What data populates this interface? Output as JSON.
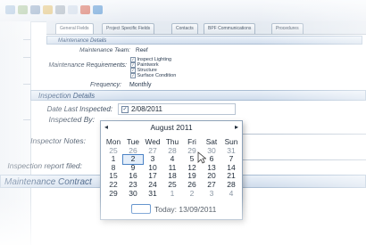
{
  "tabs": [
    {
      "label": "General Fields"
    },
    {
      "label": "Project Specific Fields"
    },
    {
      "label": "Contacts"
    },
    {
      "label": "BPF Communications"
    },
    {
      "label": "Procedures"
    }
  ],
  "maintenance_details": {
    "header": "Maintenance Details",
    "team_label": "Maintenance Team:",
    "team_value": "Reef",
    "requirements_label": "Maintenance Requirements:",
    "requirements": [
      {
        "label": "Inspect Lighting",
        "checked": true
      },
      {
        "label": "Paintwork",
        "checked": true
      },
      {
        "label": "Structure",
        "checked": true
      },
      {
        "label": "Surface Condition",
        "checked": true
      }
    ],
    "frequency_label": "Frequency:",
    "frequency_value": "Monthly"
  },
  "inspection_details": {
    "header": "Inspection Details",
    "date_label": "Date Last Inspected:",
    "date_value": "2/08/2011",
    "inspected_by_label": "Inspected By:",
    "notes_label": "Inspector Notes:",
    "report_label": "Inspection report filed:"
  },
  "contract_header": "Maintenance Contract",
  "calendar": {
    "month_label": "August 2011",
    "prev": "◂",
    "next": "▸",
    "weekdays": [
      "Mon",
      "Tue",
      "Wed",
      "Thu",
      "Fri",
      "Sat",
      "Sun"
    ],
    "weeks": [
      [
        {
          "d": "25",
          "dim": true
        },
        {
          "d": "26",
          "dim": true
        },
        {
          "d": "27",
          "dim": true
        },
        {
          "d": "28",
          "dim": true
        },
        {
          "d": "29",
          "dim": true
        },
        {
          "d": "30",
          "dim": true
        },
        {
          "d": "31",
          "dim": true
        }
      ],
      [
        {
          "d": "1"
        },
        {
          "d": "2",
          "sel": true
        },
        {
          "d": "3"
        },
        {
          "d": "4"
        },
        {
          "d": "5"
        },
        {
          "d": "6"
        },
        {
          "d": "7"
        }
      ],
      [
        {
          "d": "8"
        },
        {
          "d": "9"
        },
        {
          "d": "10"
        },
        {
          "d": "11"
        },
        {
          "d": "12"
        },
        {
          "d": "13"
        },
        {
          "d": "14"
        }
      ],
      [
        {
          "d": "15"
        },
        {
          "d": "16"
        },
        {
          "d": "17"
        },
        {
          "d": "18"
        },
        {
          "d": "19"
        },
        {
          "d": "20"
        },
        {
          "d": "21"
        }
      ],
      [
        {
          "d": "22"
        },
        {
          "d": "23"
        },
        {
          "d": "24"
        },
        {
          "d": "25"
        },
        {
          "d": "26"
        },
        {
          "d": "27"
        },
        {
          "d": "28"
        }
      ],
      [
        {
          "d": "29"
        },
        {
          "d": "30"
        },
        {
          "d": "31"
        },
        {
          "d": "1",
          "dim": true
        },
        {
          "d": "2",
          "dim": true
        },
        {
          "d": "3",
          "dim": true
        },
        {
          "d": "4",
          "dim": true
        }
      ]
    ],
    "today_label": "Today: 13/09/2011"
  },
  "colors": {
    "accent": "#4a82c5",
    "header_text": "#2a4a74"
  }
}
